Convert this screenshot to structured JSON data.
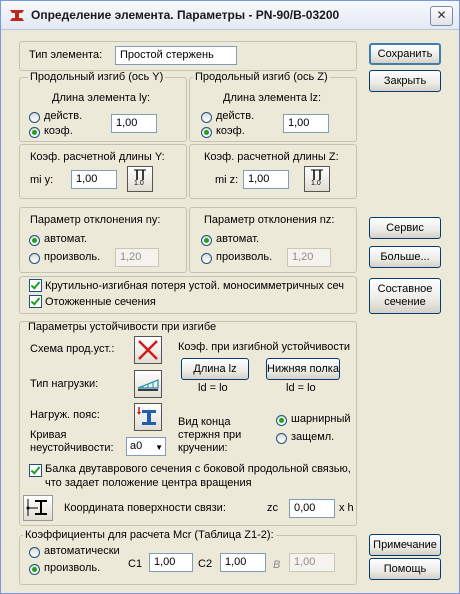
{
  "window": {
    "title": "Определение элемента. Параметры - PN-90/B-03200",
    "close_glyph": "✕"
  },
  "element_type": {
    "label": "Тип элемента:",
    "value": "Простой стержень"
  },
  "buckling_y": {
    "heading": "Продольный изгиб (ось Y)",
    "length_label": "Длина элемента ly:",
    "options": [
      "действ.",
      "коэф."
    ],
    "selected": 1,
    "value": "1,00"
  },
  "buckling_z": {
    "heading": "Продольный изгиб (ось Z)",
    "length_label": "Длина элемента lz:",
    "options": [
      "действ.",
      "коэф."
    ],
    "selected": 1,
    "value": "1,00"
  },
  "coef_y": {
    "heading": "Коэф. расчетной длины  Y:",
    "mi_label": "mi y:",
    "mi_value": "1,00",
    "icon_value": "1.0"
  },
  "coef_z": {
    "heading": "Коэф. расчетной длины  Z:",
    "mi_label": "mi z:",
    "mi_value": "1,00",
    "icon_value": "1.0"
  },
  "deviation_y": {
    "heading": "Параметр отклонения ny:",
    "options": [
      "автомат.",
      "произволь."
    ],
    "selected": 0,
    "value": "1,20"
  },
  "deviation_z": {
    "heading": "Параметр отклонения nz:",
    "options": [
      "автомат.",
      "произволь."
    ],
    "selected": 0,
    "value": "1,20"
  },
  "checks": {
    "torsional": {
      "label": "Крутильно-изгибная потеря устой. моносимметричных сеч",
      "checked": true
    },
    "annealed": {
      "label": "Отожженные сечения",
      "checked": true
    }
  },
  "lt_stability": {
    "heading": "Параметры устойчивости при изгибе",
    "scheme_label": "Схема прод.уст.:",
    "load_type_label": "Тип нагрузки:",
    "load_belt_label": "Нагруж. пояс:",
    "curve_label_line1": "Кривая",
    "curve_label_line2": "неустойчивости:",
    "curve_value": "a0",
    "coef_heading": "Коэф. при изгибной устойчивости",
    "length_button": "Длина lz",
    "lower_belt_button": "Нижняя полка",
    "ld_left": "ld = lo",
    "ld_right": "ld = lo",
    "end_type_line1": "Вид конца",
    "end_type_line2": "стержня при",
    "end_type_line3": "кручении:",
    "end_options": [
      "шарнирный",
      "защемл."
    ],
    "end_selected": 0,
    "beam_check_line1": "Балка двутаврового сечения с боковой продольной связью,",
    "beam_check_line2": "что задает положение центра вращения",
    "beam_checked": true,
    "coord_label": "Координата поверхности связи:",
    "zc_label": "zc",
    "zc_value": "0,00",
    "zc_unit": "x h"
  },
  "mcr": {
    "heading": "Коэффициенты для расчета Mcr (Таблица Z1-2):",
    "options": [
      "автоматически",
      "произволь."
    ],
    "selected": 1,
    "c1_label": "C1",
    "c1_value": "1,00",
    "c2_label": "C2",
    "c2_value": "1,00",
    "b_label": "B",
    "b_value": "1,00"
  },
  "buttons": {
    "save": "Сохранить",
    "close": "Закрыть",
    "service": "Сервис",
    "more": "Больше...",
    "composite_line1": "Составное",
    "composite_line2": "сечение",
    "note": "Примечание",
    "help": "Помощь"
  }
}
